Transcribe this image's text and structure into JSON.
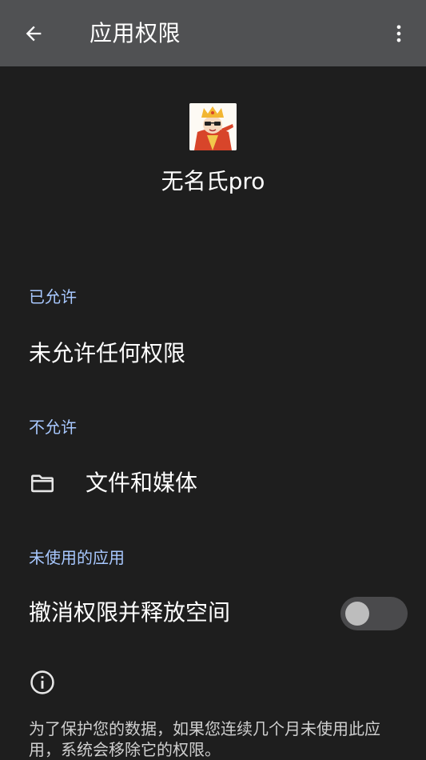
{
  "appbar": {
    "title": "应用权限",
    "back_icon": "arrow-left-icon",
    "more_icon": "more-vert-icon"
  },
  "app": {
    "name": "无名氏pro",
    "icon": "app-avatar-icon"
  },
  "sections": {
    "allowed": {
      "header": "已允许",
      "empty_text": "未允许任何权限"
    },
    "denied": {
      "header": "不允许",
      "items": [
        {
          "label": "文件和媒体",
          "icon": "folder-icon"
        }
      ]
    },
    "unused": {
      "header": "未使用的应用",
      "toggle_label": "撤消权限并释放空间",
      "toggle_on": false
    }
  },
  "footer": {
    "icon": "info-icon",
    "text": "为了保护您的数据，如果您连续几个月未使用此应用，系统会移除它的权限。"
  },
  "colors": {
    "background": "#1e1e1e",
    "appbar": "#505153",
    "section_header": "#a8c8ff",
    "text": "#ffffff"
  }
}
